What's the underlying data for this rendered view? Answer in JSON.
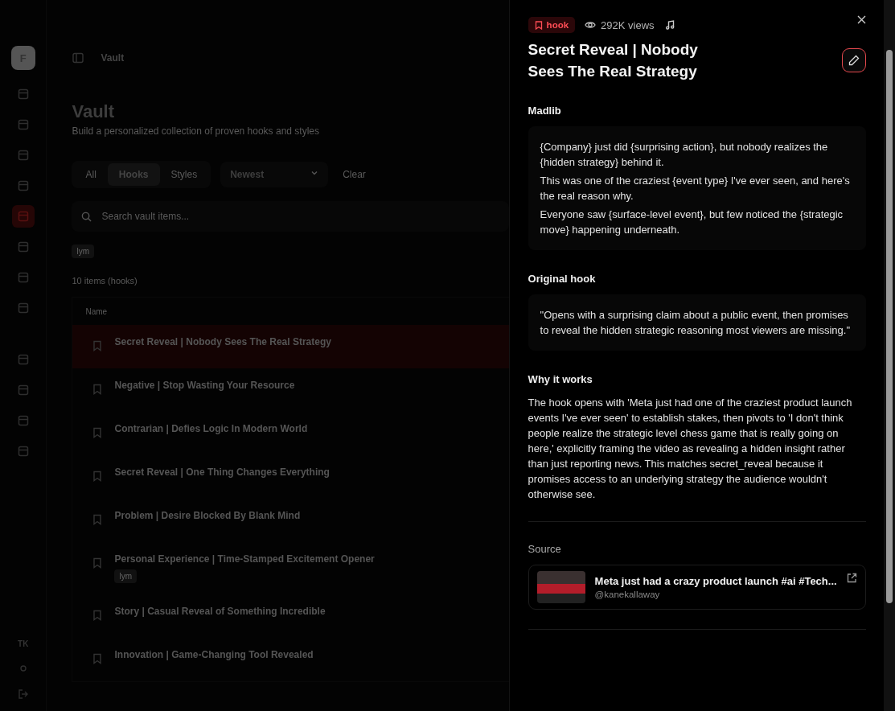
{
  "sidebar": {
    "avatar": "F",
    "items": [
      {
        "selected": false
      },
      {
        "selected": false
      },
      {
        "selected": false
      },
      {
        "selected": false
      },
      {
        "selected": true
      },
      {
        "selected": false
      },
      {
        "selected": false
      },
      {
        "selected": false
      },
      {
        "selected": false
      },
      {
        "selected": false
      },
      {
        "selected": false
      },
      {
        "selected": false
      }
    ],
    "initials": "TK"
  },
  "breadcrumb": "Vault",
  "page": {
    "title": "Vault",
    "subtitle": "Build a personalized collection of proven hooks and styles"
  },
  "filters": [
    {
      "label": "All",
      "selected": false
    },
    {
      "label": "Hooks",
      "selected": true
    },
    {
      "label": "Styles",
      "selected": false
    }
  ],
  "sort": {
    "value": "Newest"
  },
  "clear": "Clear",
  "search": {
    "placeholder": "Search vault items..."
  },
  "tags": [
    "lym"
  ],
  "count": "10 items (hooks)",
  "table": {
    "columns": [
      "Name"
    ],
    "rows": [
      {
        "title": "Secret Reveal | Nobody Sees The Real Strategy",
        "selected": true
      },
      {
        "title": "Negative | Stop Wasting Your Resource",
        "selected": false
      },
      {
        "title": "Contrarian | Defies Logic In Modern World",
        "selected": false
      },
      {
        "title": "Secret Reveal | One Thing Changes Everything",
        "selected": false
      },
      {
        "title": "Problem | Desire Blocked By Blank Mind",
        "selected": false
      },
      {
        "title": "Personal Experience | Time-Stamped Excitement Opener",
        "selected": false,
        "tag": "lym"
      },
      {
        "title": "Story | Casual Reveal of Something Incredible",
        "selected": false
      },
      {
        "title": "Innovation | Game-Changing Tool Revealed",
        "selected": false
      }
    ]
  },
  "panel": {
    "badge": "hook",
    "views": "292K views",
    "title": "Secret Reveal | Nobody Sees The Real Strategy",
    "madlib": {
      "label": "Madlib",
      "lines": [
        "{Company} just did {surprising action}, but nobody realizes the {hidden strategy} behind it.",
        "This was one of the craziest {event type} I've ever seen, and here's the real reason why.",
        "Everyone saw {surface-level event}, but few noticed the {strategic move} happening underneath."
      ]
    },
    "original": {
      "label": "Original hook",
      "text": "\"Opens with a surprising claim about a public event, then promises to reveal the hidden strategic reasoning most viewers are missing.\""
    },
    "why": {
      "label": "Why it works",
      "text": "The hook opens with 'Meta just had one of the craziest product launch events I've ever seen' to establish stakes, then pivots to 'I don't think people realize the strategic level chess game that is really going on here,' explicitly framing the video as revealing a hidden insight rather than just reporting news. This matches secret_reveal because it promises access to an underlying strategy the audience wouldn't otherwise see."
    },
    "source": {
      "label": "Source",
      "title": "Meta just had a crazy product launch #ai #Tech...",
      "handle": "@kanekallaway"
    }
  }
}
